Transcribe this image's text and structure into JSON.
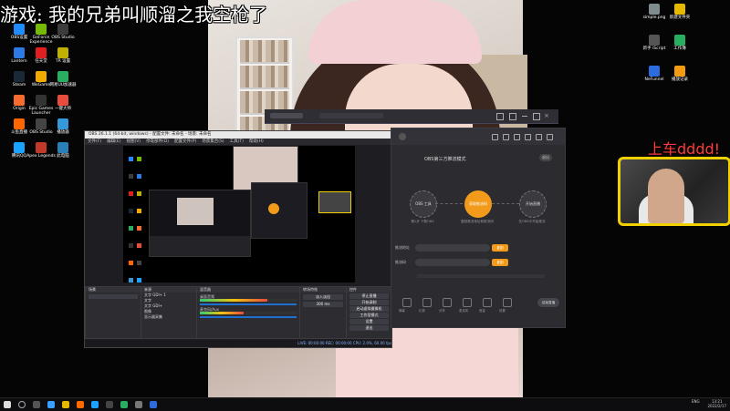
{
  "stream": {
    "title": "游戏: 我的兄弟叫顺溜之我空枪了",
    "overlay_text": "上车dddd!"
  },
  "desktop_left_icons": [
    {
      "label": "OBS设置",
      "color": "#1e8cff"
    },
    {
      "label": "GeForce Experience",
      "color": "#76b900"
    },
    {
      "label": "OBS Studio",
      "color": "#3c3c3c"
    },
    {
      "label": "Lantern",
      "color": "#2c7be5"
    },
    {
      "label": "任天堂",
      "color": "#e02020"
    },
    {
      "label": "TR 设置",
      "color": "#c0b000"
    },
    {
      "label": "Steam",
      "color": "#1b2838"
    },
    {
      "label": "WeGame",
      "color": "#f2a900"
    },
    {
      "label": "网易UU加速器",
      "color": "#27ae60"
    },
    {
      "label": "Origin",
      "color": "#f56c2d"
    },
    {
      "label": "Epic Games Launcher",
      "color": "#333333"
    },
    {
      "label": "一键大师",
      "color": "#e74c3c"
    },
    {
      "label": "斗鱼直播",
      "color": "#ff6600"
    },
    {
      "label": "OBS Studio",
      "color": "#444444"
    },
    {
      "label": "播放器",
      "color": "#3498db"
    },
    {
      "label": "腾讯QQ",
      "color": "#1aa3ff"
    },
    {
      "label": "Apex Legends",
      "color": "#c0392b"
    },
    {
      "label": "此电脑",
      "color": "#2980b9"
    }
  ],
  "desktop_right_icons": [
    {
      "label": "simple.png",
      "color": "#7f8c8d"
    },
    {
      "label": "新建文件夹",
      "color": "#e6b800"
    },
    {
      "label": "新手 iScript",
      "color": "#555555"
    },
    {
      "label": "工作簿",
      "color": "#27ae60"
    },
    {
      "label": "NeFunnel",
      "color": "#2d6cdf"
    },
    {
      "label": "播放记录",
      "color": "#f39c12"
    }
  ],
  "obs": {
    "title": "OBS 26.1.1 (64-bit, windows) - 配置文件: 未命名 - 场景: 未命名",
    "menu": [
      "文件(F)",
      "编辑(E)",
      "视图(V)",
      "停靠部件(D)",
      "配置文件(P)",
      "场景集合(S)",
      "工具(T)",
      "帮助(H)"
    ],
    "docks": {
      "scenes": "场景",
      "sources": "来源",
      "mixer": "混音器",
      "transitions": "转场特效",
      "controls": "控件"
    },
    "sources_list": [
      "文字 GDI+ 1",
      "文字",
      "文字 GDI+",
      "图像",
      "显示器采集"
    ],
    "mixer_channels": [
      {
        "name": "桌面音频",
        "level": 0.7
      },
      {
        "name": "麦克风/Aux",
        "level": 0.45
      }
    ],
    "transition_value": "300 ms",
    "controls": [
      "停止直播",
      "开始录制",
      "启动虚拟摄像机",
      "工作室模式",
      "设置",
      "退出"
    ],
    "status": "LIVE: 00:00:00   REC: 00:00:00   CPU: 2.0%, 60.00 fps"
  },
  "assistant": {
    "title": "OBS第三方推流模式",
    "close_label": "退出",
    "steps": [
      {
        "label": "OBS 工具",
        "caption": "第1步 下载OBS",
        "active": false
      },
      {
        "label": "获取推流码",
        "caption": "复制推流地址和推流码",
        "active": true
      },
      {
        "label": "开始直播",
        "caption": "在OBS中开始推流",
        "active": false
      }
    ],
    "rows": [
      {
        "label": "推流地址",
        "button": "复制"
      },
      {
        "label": "推流码",
        "button": "复制"
      }
    ],
    "footer_items": [
      "弹幕",
      "礼物",
      "分享",
      "麦克风",
      "音量",
      "设置"
    ],
    "footer_button": "结束直播"
  },
  "taskbar": {
    "time": "13:21",
    "date": "2022/2/17",
    "lang": "ENG"
  }
}
